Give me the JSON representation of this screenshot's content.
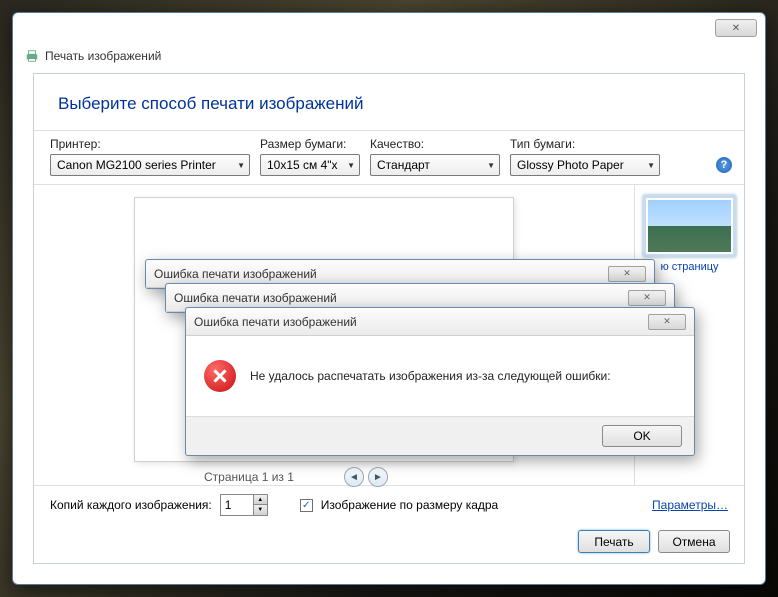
{
  "window": {
    "title": "Печать изображений"
  },
  "heading": "Выберите способ печати изображений",
  "labels": {
    "printer": "Принтер:",
    "paper_size": "Размер бумаги:",
    "quality": "Качество:",
    "paper_type": "Тип бумаги:"
  },
  "dropdowns": {
    "printer": "Canon MG2100 series Printer",
    "paper_size": "10x15 см 4\"x",
    "quality": "Стандарт",
    "paper_type": "Glossy Photo Paper"
  },
  "preview": {
    "page_indicator": "Страница 1 из 1"
  },
  "thumb": {
    "label": "ю страницу"
  },
  "copies": {
    "label": "Копий каждого изображения:",
    "value": "1"
  },
  "fit": {
    "label": "Изображение по размеру кадра",
    "checked": true
  },
  "links": {
    "params": "Параметры…"
  },
  "buttons": {
    "print": "Печать",
    "cancel": "Отмена"
  },
  "error": {
    "title": "Ошибка печати изображений",
    "message": "Не удалось распечатать изображения из-за следующей ошибки:",
    "ok": "OK"
  }
}
